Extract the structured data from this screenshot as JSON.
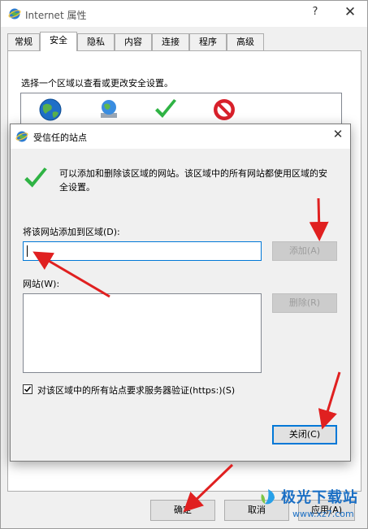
{
  "outer_window": {
    "title": "Internet 属性",
    "help_glyph": "?",
    "close_glyph": "✕",
    "tabs": [
      "常规",
      "安全",
      "隐私",
      "内容",
      "连接",
      "程序",
      "高级"
    ],
    "active_tab": "安全",
    "zone_caption": "选择一个区域以查看或更改安全设置。",
    "buttons": {
      "ok": "确定",
      "cancel": "取消",
      "apply": "应用(A)"
    }
  },
  "dialog": {
    "title": "受信任的站点",
    "close_glyph": "✕",
    "description": "可以添加和删除该区域的网站。该区域中的所有网站都使用区域的安全设置。",
    "add_label": "将该网站添加到区域(D):",
    "site_input_value": "",
    "add_button": "添加(A)",
    "websites_label": "网站(W):",
    "websites": [],
    "remove_button": "删除(R)",
    "https_check_label": "对该区域中的所有站点要求服务器验证(https:)(S)",
    "https_checked": true,
    "close_button": "关闭(C)"
  },
  "watermark": {
    "brand": "极光下载站",
    "url": "www.xz7.com"
  },
  "colors": {
    "annotation": "#e02020",
    "accent": "#0078d7",
    "check_green": "#2fb344",
    "restricted_red": "#d8202a"
  }
}
